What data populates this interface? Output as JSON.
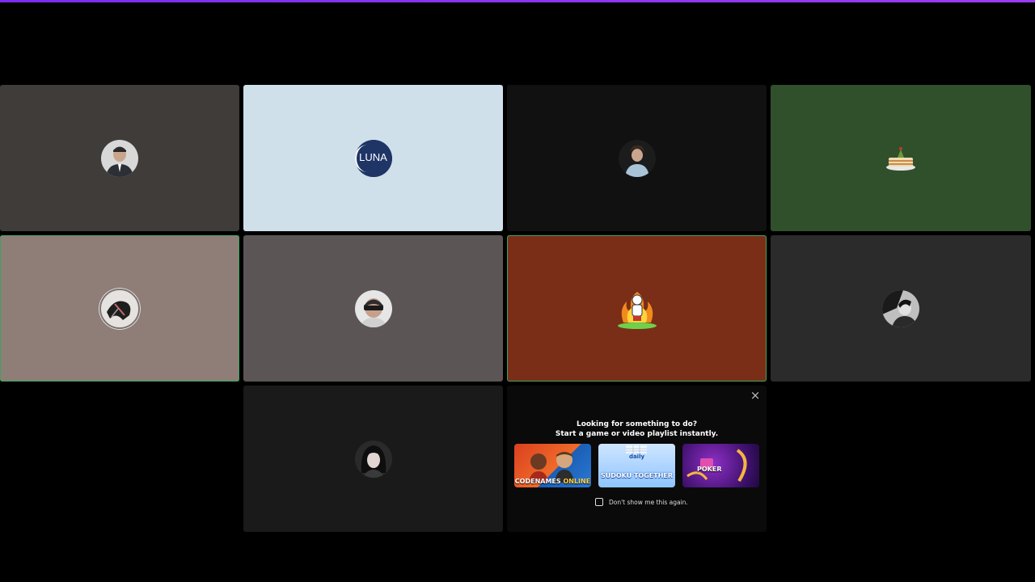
{
  "colors": {
    "accent": "#8b33f5",
    "speaking_border": "#3ba55d"
  },
  "tiles": [
    {
      "id": "t1",
      "bg": "#403c3a",
      "avatar": "person-photo-avatar",
      "speaking": false
    },
    {
      "id": "t2",
      "bg": "#d0e0ea",
      "avatar": "luna-logo-avatar",
      "speaking": false
    },
    {
      "id": "t3",
      "bg": "#111111",
      "avatar": "person-photo-avatar",
      "speaking": false
    },
    {
      "id": "t4",
      "bg": "#30502c",
      "avatar": "cake-avatar",
      "speaking": false
    },
    {
      "id": "t5",
      "bg": "#8f7d78",
      "avatar": "sketch-avatar",
      "speaking": true
    },
    {
      "id": "t6",
      "bg": "#5b5655",
      "avatar": "person-photo-avatar",
      "speaking": false
    },
    {
      "id": "t7",
      "bg": "#7a2e18",
      "avatar": "cartoon-avatar",
      "speaking": true
    },
    {
      "id": "t8",
      "bg": "#2b2b2b",
      "avatar": "bw-photo-avatar",
      "speaking": false
    },
    {
      "id": "t9",
      "bg": "#1a1a1a",
      "avatar": "person-photo-avatar",
      "speaking": false
    }
  ],
  "luna_logo_text": "LUNA",
  "activity_panel": {
    "heading": "Looking for something to do?",
    "subheading": "Start a game or video playlist instantly.",
    "close_icon": "×",
    "cards": [
      {
        "name": "CODENAMES",
        "suffix": "ONLINE"
      },
      {
        "top": "daily",
        "name": "SUDOKU TOGETHER"
      },
      {
        "name": "POKER"
      }
    ],
    "dont_show_label": "Don't show me this again."
  }
}
